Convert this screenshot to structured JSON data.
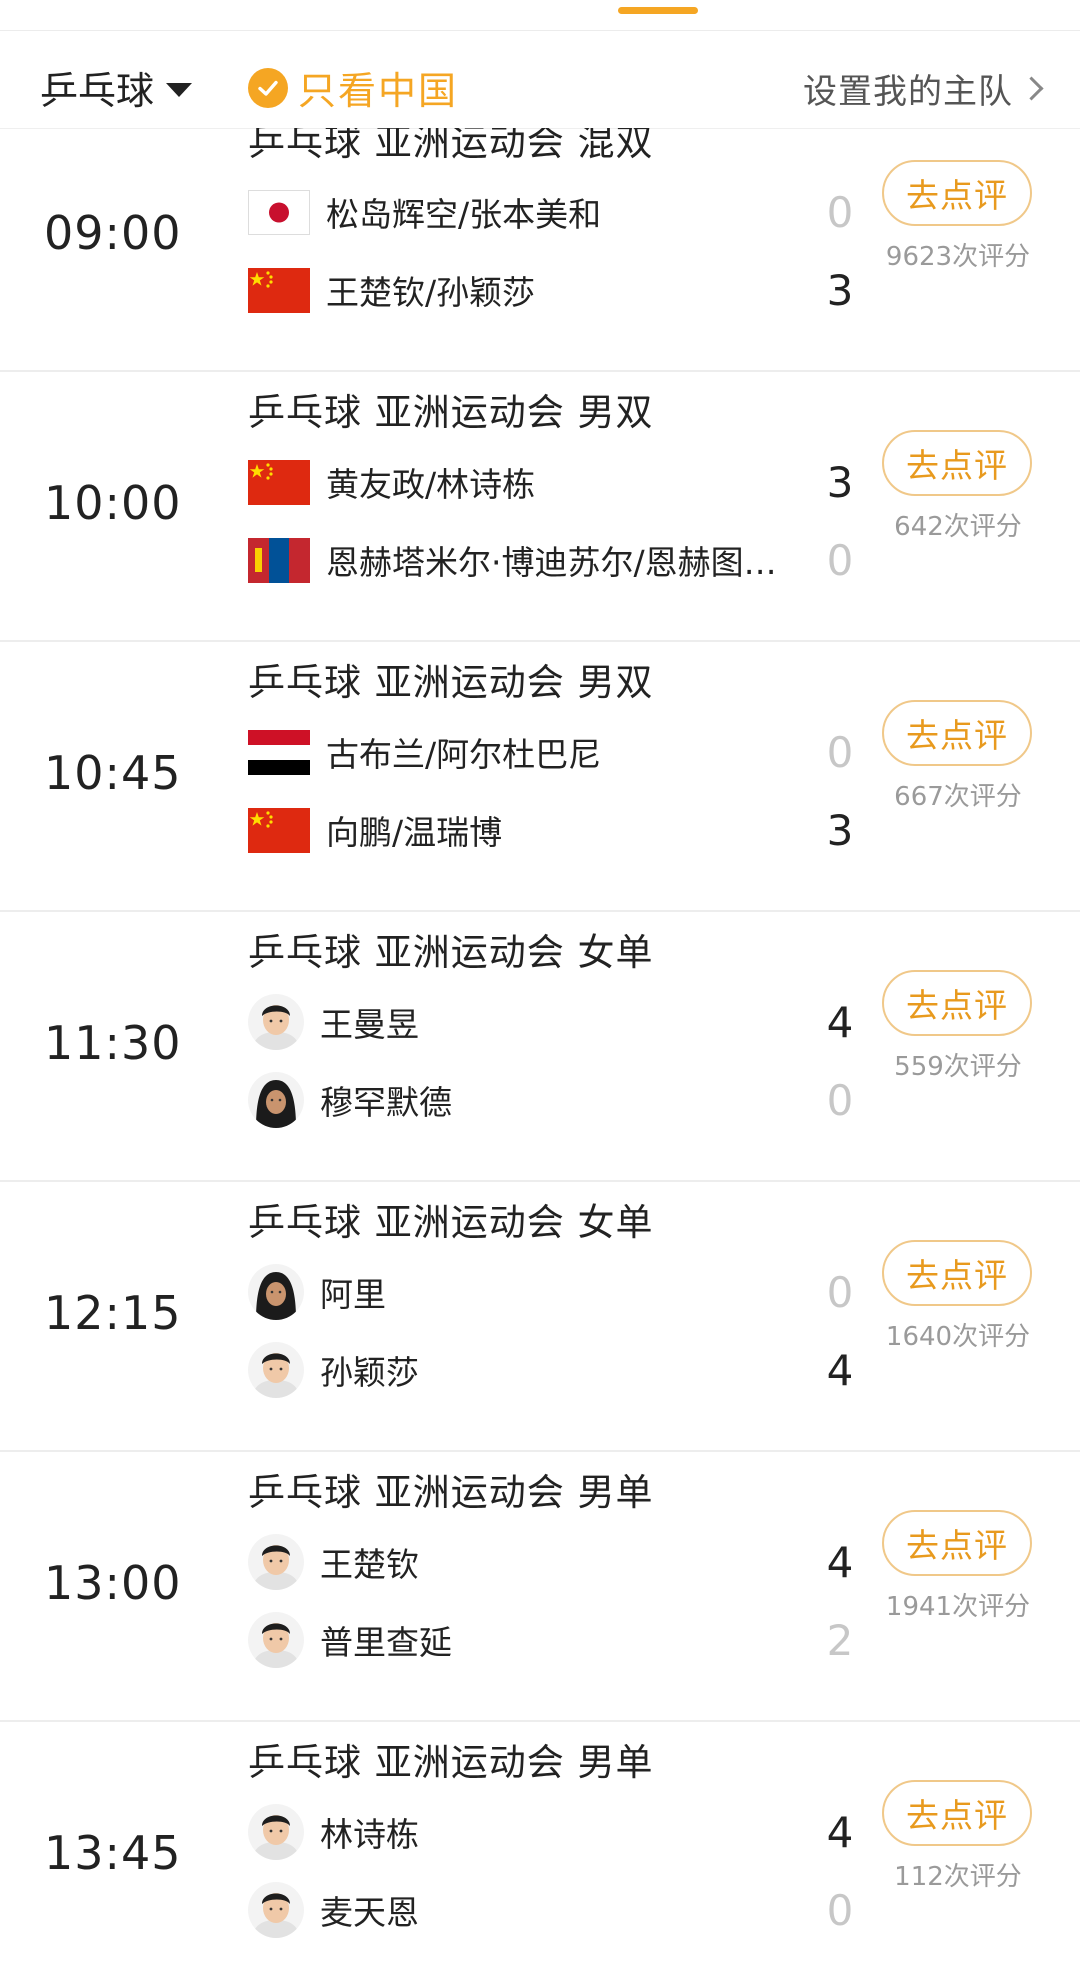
{
  "header": {
    "sport": "乒乓球",
    "china_only": "只看中国",
    "set_team": "设置我的主队"
  },
  "colors": {
    "accent": "#f5a623",
    "win_score": "#222222",
    "lose_score": "#c7c7c7"
  },
  "matches": [
    {
      "time": "09:00",
      "event": "乒乓球 亚洲运动会 混双",
      "team_a": {
        "name": "松岛辉空/张本美和",
        "score": "0",
        "icon": "japan-flag-icon"
      },
      "team_b": {
        "name": "王楚钦/孙颖莎",
        "score": "3",
        "icon": "china-flag-icon"
      },
      "button": "去点评",
      "ratings": "9623次评分"
    },
    {
      "time": "10:00",
      "event": "乒乓球 亚洲运动会 男双",
      "team_a": {
        "name": "黄友政/林诗栋",
        "score": "3",
        "icon": "china-flag-icon"
      },
      "team_b": {
        "name": "恩赫塔米尔·博迪苏尔/恩赫图…",
        "score": "0",
        "icon": "mongolia-flag-icon"
      },
      "button": "去点评",
      "ratings": "642次评分"
    },
    {
      "time": "10:45",
      "event": "乒乓球 亚洲运动会 男双",
      "team_a": {
        "name": "古布兰/阿尔杜巴尼",
        "score": "0",
        "icon": "yemen-flag-icon"
      },
      "team_b": {
        "name": "向鹏/温瑞博",
        "score": "3",
        "icon": "china-flag-icon"
      },
      "button": "去点评",
      "ratings": "667次评分"
    },
    {
      "time": "11:30",
      "event": "乒乓球 亚洲运动会 女单",
      "team_a": {
        "name": "王曼昱",
        "score": "4",
        "icon": "player-avatar-icon"
      },
      "team_b": {
        "name": "穆罕默德",
        "score": "0",
        "icon": "player-avatar-hijab-icon"
      },
      "button": "去点评",
      "ratings": "559次评分"
    },
    {
      "time": "12:15",
      "event": "乒乓球 亚洲运动会 女单",
      "team_a": {
        "name": "阿里",
        "score": "0",
        "icon": "player-avatar-hijab-icon"
      },
      "team_b": {
        "name": "孙颖莎",
        "score": "4",
        "icon": "player-avatar-icon"
      },
      "button": "去点评",
      "ratings": "1640次评分"
    },
    {
      "time": "13:00",
      "event": "乒乓球 亚洲运动会 男单",
      "team_a": {
        "name": "王楚钦",
        "score": "4",
        "icon": "player-avatar-icon"
      },
      "team_b": {
        "name": "普里查延",
        "score": "2",
        "icon": "player-avatar-icon"
      },
      "button": "去点评",
      "ratings": "1941次评分"
    },
    {
      "time": "13:45",
      "event": "乒乓球 亚洲运动会 男单",
      "team_a": {
        "name": "林诗栋",
        "score": "4",
        "icon": "player-avatar-icon"
      },
      "team_b": {
        "name": "麦天恩",
        "score": "0",
        "icon": "player-avatar-icon"
      },
      "button": "去点评",
      "ratings": "112次评分"
    }
  ]
}
